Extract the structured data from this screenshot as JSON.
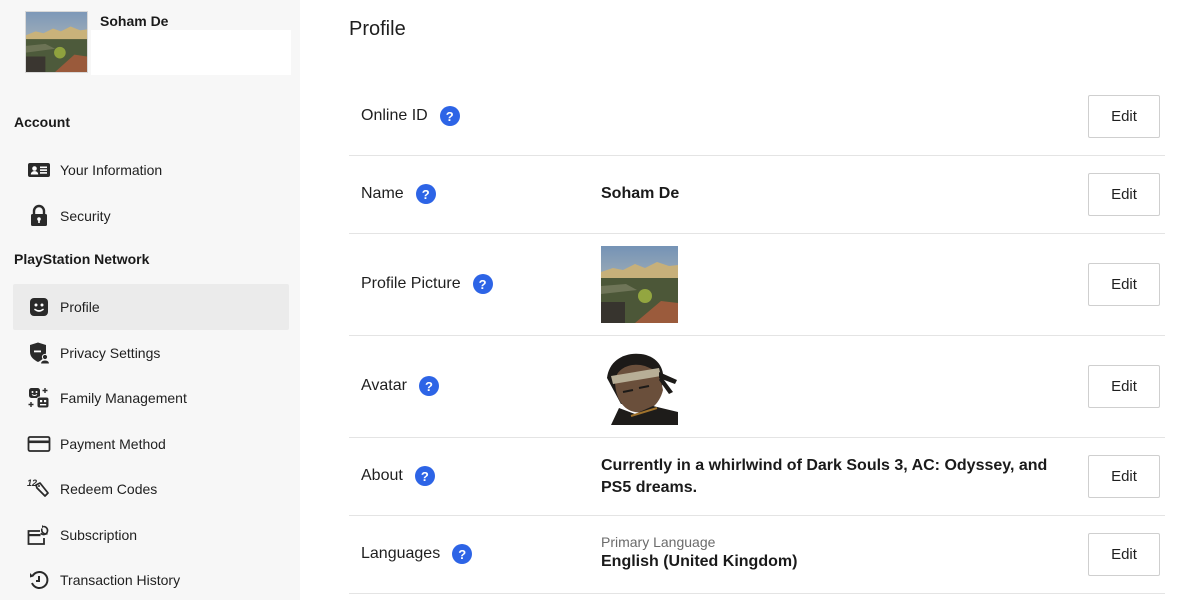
{
  "user": {
    "name": "Soham De",
    "picture_icon": "landscape-photo"
  },
  "sidebar": {
    "sections": [
      {
        "title": "Account",
        "items": [
          {
            "label": "Your Information",
            "icon": "id-card-icon"
          },
          {
            "label": "Security",
            "icon": "lock-icon"
          }
        ]
      },
      {
        "title": "PlayStation Network",
        "items": [
          {
            "label": "Profile",
            "icon": "smile-face-icon",
            "active": true
          },
          {
            "label": "Privacy Settings",
            "icon": "shield-user-icon"
          },
          {
            "label": "Family Management",
            "icon": "family-icon"
          },
          {
            "label": "Payment Method",
            "icon": "credit-card-icon"
          },
          {
            "label": "Redeem Codes",
            "icon": "redeem-code-icon"
          },
          {
            "label": "Subscription",
            "icon": "subscription-icon"
          },
          {
            "label": "Transaction History",
            "icon": "history-icon"
          }
        ]
      }
    ]
  },
  "main": {
    "title": "Profile",
    "help_glyph": "?",
    "edit_label": "Edit",
    "rows": [
      {
        "label": "Online ID",
        "value": ""
      },
      {
        "label": "Name",
        "value": "Soham De"
      },
      {
        "label": "Profile Picture",
        "value_type": "image"
      },
      {
        "label": "Avatar",
        "value_type": "image"
      },
      {
        "label": "About",
        "value": "Currently in a whirlwind of Dark Souls 3, AC: Odyssey, and PS5 dreams."
      },
      {
        "label": "Languages",
        "sublabel": "Primary Language",
        "value": "English (United Kingdom)"
      }
    ]
  },
  "colors": {
    "help_icon": "#2d64e6",
    "sidebar_bg": "#f7f7f7",
    "active_item_bg": "#ebebeb"
  }
}
